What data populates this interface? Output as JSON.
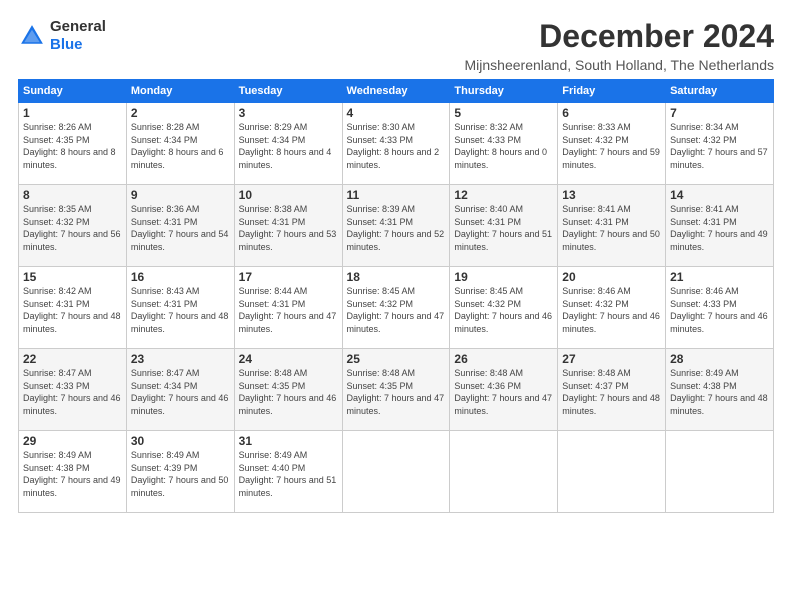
{
  "header": {
    "logo_general": "General",
    "logo_blue": "Blue",
    "title": "December 2024",
    "subtitle": "Mijnsheerenland, South Holland, The Netherlands"
  },
  "calendar": {
    "headers": [
      "Sunday",
      "Monday",
      "Tuesday",
      "Wednesday",
      "Thursday",
      "Friday",
      "Saturday"
    ],
    "weeks": [
      [
        {
          "day": "1",
          "info": "Sunrise: 8:26 AM\nSunset: 4:35 PM\nDaylight: 8 hours\nand 8 minutes."
        },
        {
          "day": "2",
          "info": "Sunrise: 8:28 AM\nSunset: 4:34 PM\nDaylight: 8 hours\nand 6 minutes."
        },
        {
          "day": "3",
          "info": "Sunrise: 8:29 AM\nSunset: 4:34 PM\nDaylight: 8 hours\nand 4 minutes."
        },
        {
          "day": "4",
          "info": "Sunrise: 8:30 AM\nSunset: 4:33 PM\nDaylight: 8 hours\nand 2 minutes."
        },
        {
          "day": "5",
          "info": "Sunrise: 8:32 AM\nSunset: 4:33 PM\nDaylight: 8 hours\nand 0 minutes."
        },
        {
          "day": "6",
          "info": "Sunrise: 8:33 AM\nSunset: 4:32 PM\nDaylight: 7 hours\nand 59 minutes."
        },
        {
          "day": "7",
          "info": "Sunrise: 8:34 AM\nSunset: 4:32 PM\nDaylight: 7 hours\nand 57 minutes."
        }
      ],
      [
        {
          "day": "8",
          "info": "Sunrise: 8:35 AM\nSunset: 4:32 PM\nDaylight: 7 hours\nand 56 minutes."
        },
        {
          "day": "9",
          "info": "Sunrise: 8:36 AM\nSunset: 4:31 PM\nDaylight: 7 hours\nand 54 minutes."
        },
        {
          "day": "10",
          "info": "Sunrise: 8:38 AM\nSunset: 4:31 PM\nDaylight: 7 hours\nand 53 minutes."
        },
        {
          "day": "11",
          "info": "Sunrise: 8:39 AM\nSunset: 4:31 PM\nDaylight: 7 hours\nand 52 minutes."
        },
        {
          "day": "12",
          "info": "Sunrise: 8:40 AM\nSunset: 4:31 PM\nDaylight: 7 hours\nand 51 minutes."
        },
        {
          "day": "13",
          "info": "Sunrise: 8:41 AM\nSunset: 4:31 PM\nDaylight: 7 hours\nand 50 minutes."
        },
        {
          "day": "14",
          "info": "Sunrise: 8:41 AM\nSunset: 4:31 PM\nDaylight: 7 hours\nand 49 minutes."
        }
      ],
      [
        {
          "day": "15",
          "info": "Sunrise: 8:42 AM\nSunset: 4:31 PM\nDaylight: 7 hours\nand 48 minutes."
        },
        {
          "day": "16",
          "info": "Sunrise: 8:43 AM\nSunset: 4:31 PM\nDaylight: 7 hours\nand 48 minutes."
        },
        {
          "day": "17",
          "info": "Sunrise: 8:44 AM\nSunset: 4:31 PM\nDaylight: 7 hours\nand 47 minutes."
        },
        {
          "day": "18",
          "info": "Sunrise: 8:45 AM\nSunset: 4:32 PM\nDaylight: 7 hours\nand 47 minutes."
        },
        {
          "day": "19",
          "info": "Sunrise: 8:45 AM\nSunset: 4:32 PM\nDaylight: 7 hours\nand 46 minutes."
        },
        {
          "day": "20",
          "info": "Sunrise: 8:46 AM\nSunset: 4:32 PM\nDaylight: 7 hours\nand 46 minutes."
        },
        {
          "day": "21",
          "info": "Sunrise: 8:46 AM\nSunset: 4:33 PM\nDaylight: 7 hours\nand 46 minutes."
        }
      ],
      [
        {
          "day": "22",
          "info": "Sunrise: 8:47 AM\nSunset: 4:33 PM\nDaylight: 7 hours\nand 46 minutes."
        },
        {
          "day": "23",
          "info": "Sunrise: 8:47 AM\nSunset: 4:34 PM\nDaylight: 7 hours\nand 46 minutes."
        },
        {
          "day": "24",
          "info": "Sunrise: 8:48 AM\nSunset: 4:35 PM\nDaylight: 7 hours\nand 46 minutes."
        },
        {
          "day": "25",
          "info": "Sunrise: 8:48 AM\nSunset: 4:35 PM\nDaylight: 7 hours\nand 47 minutes."
        },
        {
          "day": "26",
          "info": "Sunrise: 8:48 AM\nSunset: 4:36 PM\nDaylight: 7 hours\nand 47 minutes."
        },
        {
          "day": "27",
          "info": "Sunrise: 8:48 AM\nSunset: 4:37 PM\nDaylight: 7 hours\nand 48 minutes."
        },
        {
          "day": "28",
          "info": "Sunrise: 8:49 AM\nSunset: 4:38 PM\nDaylight: 7 hours\nand 48 minutes."
        }
      ],
      [
        {
          "day": "29",
          "info": "Sunrise: 8:49 AM\nSunset: 4:38 PM\nDaylight: 7 hours\nand 49 minutes."
        },
        {
          "day": "30",
          "info": "Sunrise: 8:49 AM\nSunset: 4:39 PM\nDaylight: 7 hours\nand 50 minutes."
        },
        {
          "day": "31",
          "info": "Sunrise: 8:49 AM\nSunset: 4:40 PM\nDaylight: 7 hours\nand 51 minutes."
        },
        {
          "day": "",
          "info": ""
        },
        {
          "day": "",
          "info": ""
        },
        {
          "day": "",
          "info": ""
        },
        {
          "day": "",
          "info": ""
        }
      ]
    ]
  }
}
